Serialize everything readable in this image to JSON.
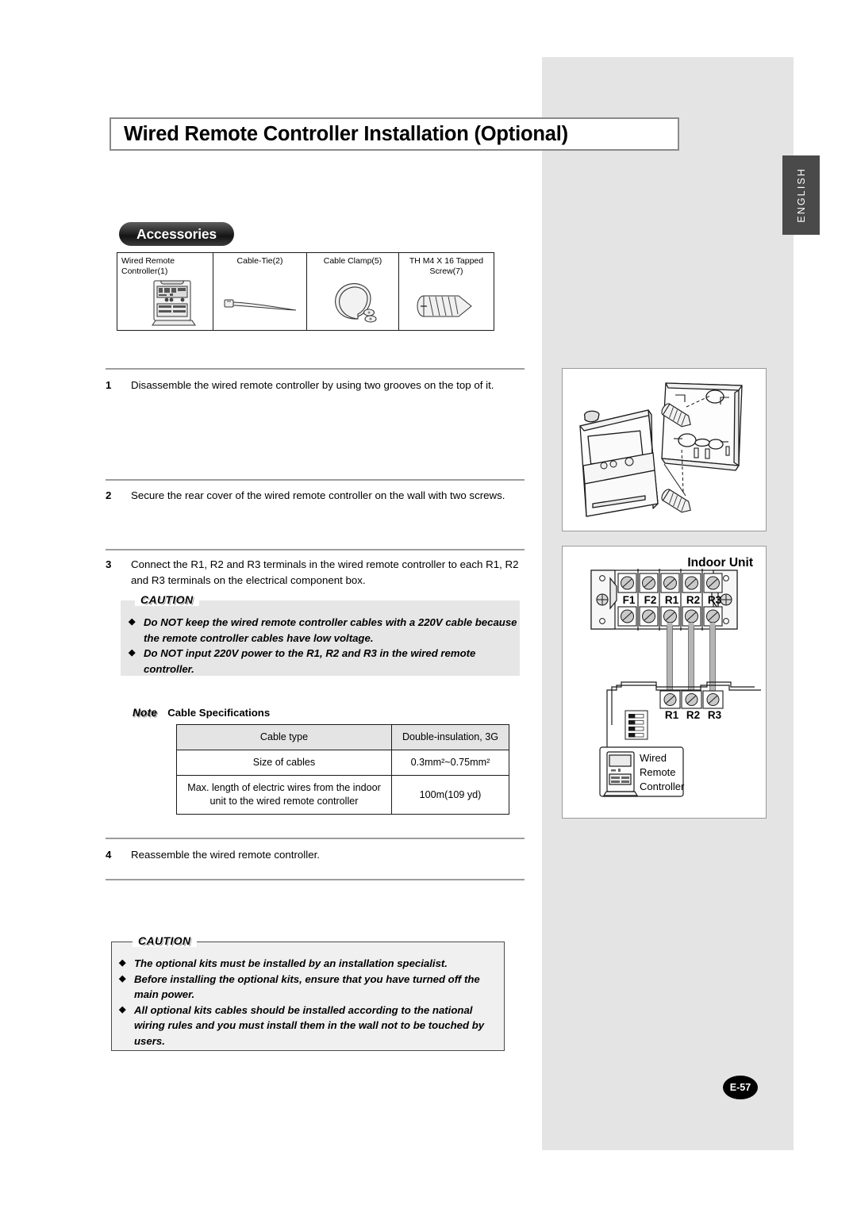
{
  "document": {
    "title": "Wired Remote Controller Installation (Optional)",
    "language_tab": "ENGLISH",
    "page_number": "E-57"
  },
  "accessories": {
    "heading": "Accessories",
    "items": [
      {
        "label_line1": "Wired Remote",
        "label_line2": "Controller(1)",
        "icon": "wired-remote-controller-icon"
      },
      {
        "label_line1": "Cable-Tie(2)",
        "label_line2": "",
        "icon": "cable-tie-icon"
      },
      {
        "label_line1": "Cable Clamp(5)",
        "label_line2": "",
        "icon": "cable-clamp-icon"
      },
      {
        "label_line1": "TH M4 X 16 Tapped",
        "label_line2": "Screw(7)",
        "icon": "tapped-screw-icon"
      }
    ]
  },
  "steps": [
    {
      "num": "1",
      "text": "Disassemble the wired remote controller by using two grooves on the top of it."
    },
    {
      "num": "2",
      "text": "Secure the rear cover of the wired remote controller on the wall with two screws."
    },
    {
      "num": "3",
      "text": "Connect the R1, R2 and R3 terminals in the wired remote controller to each R1, R2 and R3 terminals on the electrical component box."
    },
    {
      "num": "4",
      "text": "Reassemble the wired remote controller."
    }
  ],
  "caution_top": {
    "label": "CAUTION",
    "bullets": [
      "Do NOT keep the wired remote  controller cables with a 220V cable because  the remote controller cables have low voltage.",
      "Do NOT input 220V power to the R1, R2 and R3 in the wired remote controller."
    ]
  },
  "note": {
    "label": "Note",
    "title": "Cable Specifications",
    "table": {
      "rows": [
        {
          "key": "Cable type",
          "value": "Double-insulation, 3G"
        },
        {
          "key": "Size of cables",
          "value": "0.3mm²~0.75mm²"
        },
        {
          "key": "Max. length of electric wires from the indoor unit to the wired remote controller",
          "value": "100m(109 yd)"
        }
      ]
    }
  },
  "caution_bottom": {
    "label": "CAUTION",
    "bullets": [
      "The optional kits must be installed by an installation specialist.",
      "Before installing the optional kits, ensure that you have turned off the main power.",
      "All optional kits cables should be installed according to the national wiring rules and you must install them in the wall not to be touched by users."
    ]
  },
  "figures": {
    "disassembly": {
      "name": "controller-disassembly-diagram"
    },
    "wiring": {
      "title": "Indoor Unit",
      "terminal_labels": [
        "F1",
        "F2",
        "R1",
        "R2",
        "R3"
      ],
      "remote_terminal_labels": [
        "R1",
        "R2",
        "R3"
      ],
      "device_label_line1": "Wired",
      "device_label_line2": "Remote",
      "device_label_line3": "Controller"
    }
  },
  "colors": {
    "panel_gray": "#e4e4e4",
    "tab_gray": "#4a4a4a",
    "caution_gray": "#e6e6e6",
    "ink": "#000000"
  }
}
